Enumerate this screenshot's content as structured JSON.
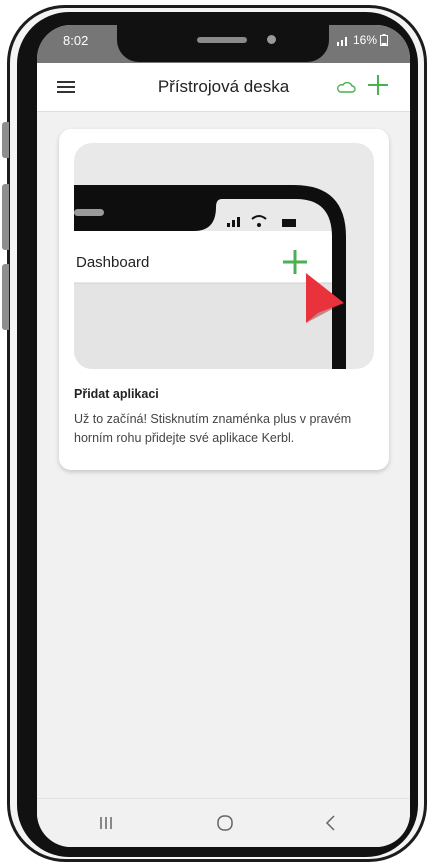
{
  "status_bar": {
    "time": "8:02",
    "battery": "16%"
  },
  "app_bar": {
    "title": "Přístrojová deska"
  },
  "card": {
    "preview": {
      "title": "Dashboard"
    },
    "title": "Přidat aplikaci",
    "description": "Už to začíná! Stisknutím znaménka plus v pravém horním rohu přidejte své aplikace Kerbl."
  },
  "colors": {
    "accent": "#4caf50",
    "arrow": "#e8333c",
    "status_bar": "#767676"
  },
  "icons": [
    "menu-icon",
    "cloud-icon",
    "plus-icon",
    "signal-icon",
    "wifi-icon",
    "battery-icon",
    "recents-icon",
    "home-icon",
    "back-icon"
  ]
}
